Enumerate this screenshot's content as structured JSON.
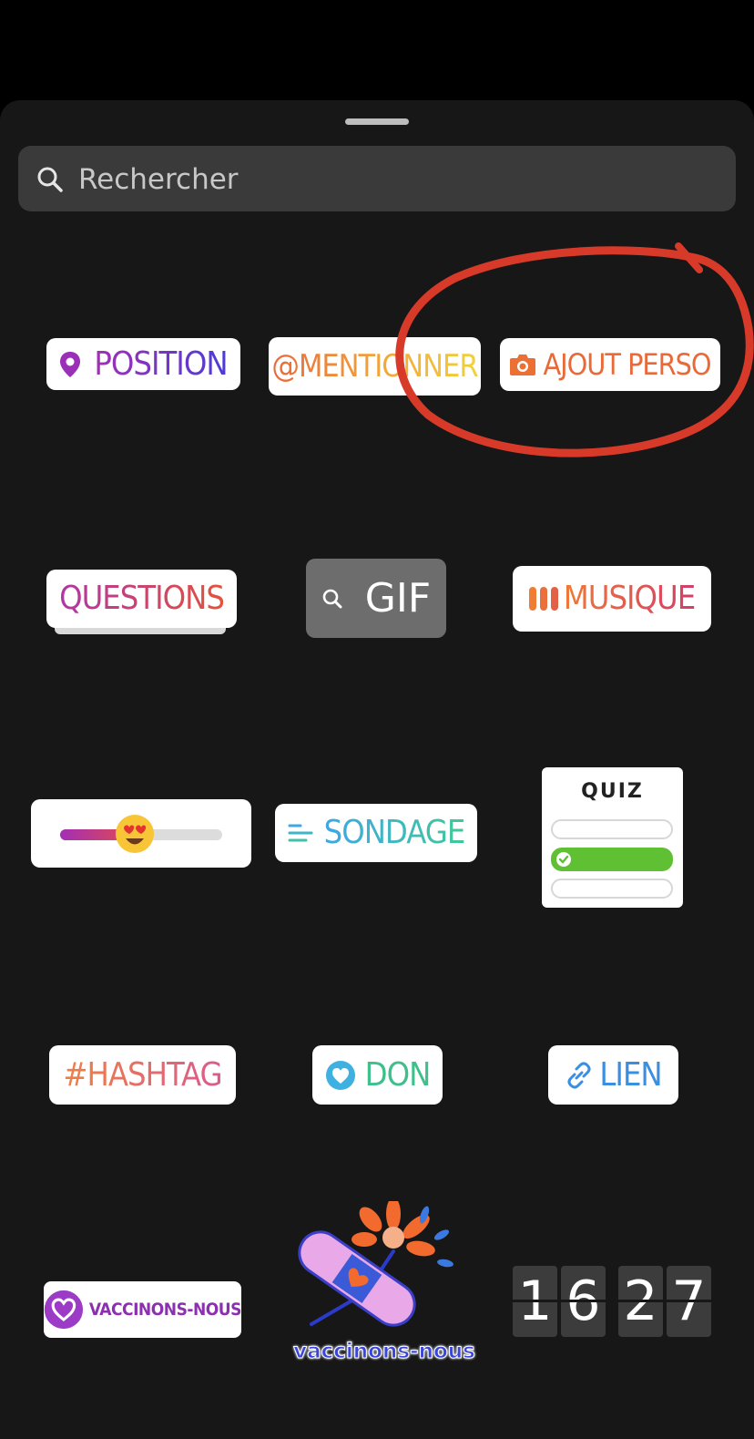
{
  "search": {
    "placeholder": "Rechercher",
    "icon": "search-icon"
  },
  "stickers": {
    "position": {
      "label": "POSITION",
      "icon": "location-pin-icon"
    },
    "mention": {
      "label": "@MENTIONNER"
    },
    "ajout_perso": {
      "label": "AJOUT PERSO",
      "icon": "camera-icon"
    },
    "questions": {
      "label": "QUESTIONS"
    },
    "gif": {
      "label": "GIF",
      "icon": "search-icon"
    },
    "musique": {
      "label": "MUSIQUE",
      "icon": "music-bars-icon"
    },
    "emoji_slider": {
      "icon": "heart-eyes-emoji-icon",
      "value": 0.48
    },
    "sondage": {
      "label": "SONDAGE",
      "icon": "poll-lines-icon"
    },
    "quiz": {
      "title": "QUIZ",
      "correct_option": 2,
      "options_count": 3
    },
    "hashtag": {
      "label": "#HASHTAG"
    },
    "don": {
      "label": "DON",
      "icon": "heart-icon"
    },
    "lien": {
      "label": "LIEN",
      "icon": "link-icon"
    },
    "vaccinons_pill": {
      "label": "VACCINONS-NOUS",
      "icon": "heart-logo-icon"
    },
    "vaccinons_sticker": {
      "label": "vaccinons-nous",
      "icon": "bandage-flower-icon"
    },
    "clock": {
      "digits": [
        "1",
        "6",
        "2",
        "7"
      ]
    }
  },
  "colors": {
    "annotation": "#d83a2a",
    "background": "#171717"
  }
}
